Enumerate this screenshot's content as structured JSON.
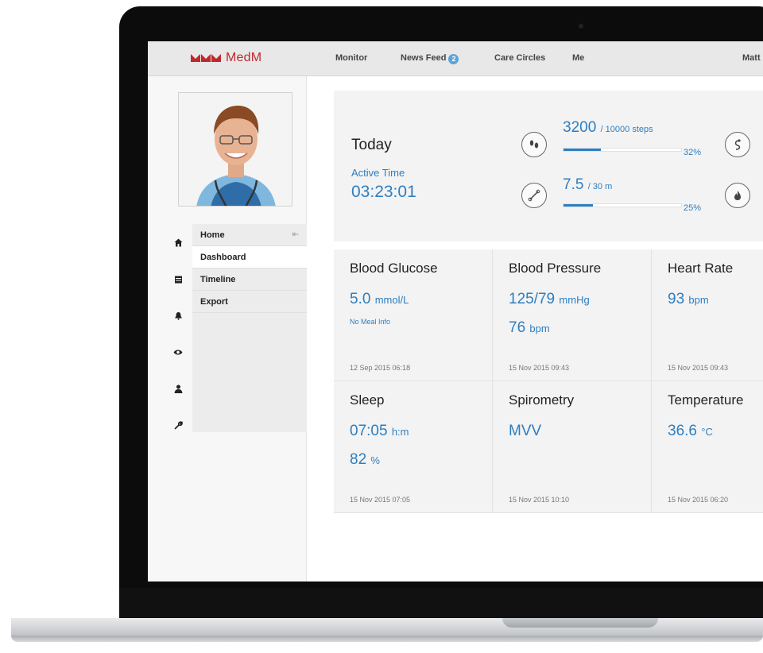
{
  "brand": {
    "name": "MedM",
    "accent": "#c0282d",
    "blue": "#2e7ec1"
  },
  "nav": {
    "items": [
      "Monitor",
      "News Feed",
      "Care Circles",
      "Me"
    ],
    "news_badge": "2",
    "user": "Matt"
  },
  "sidebar": {
    "icons": [
      "home-icon",
      "calendar-icon",
      "bell-icon",
      "eye-icon",
      "person-icon",
      "wrench-icon"
    ],
    "menu": [
      "Home",
      "Dashboard",
      "Timeline",
      "Export"
    ],
    "active": "Dashboard"
  },
  "today": {
    "title": "Today",
    "active_label": "Active Time",
    "active_value": "03:23:01",
    "steps": {
      "value": "3200",
      "unit": "/ 10000 steps",
      "percent": "32%",
      "progress": 0.32
    },
    "distance": {
      "value": "7.5",
      "unit": "/ 30 m",
      "percent": "25%",
      "progress": 0.25
    }
  },
  "tiles": [
    {
      "title": "Blood Glucose",
      "v1": "5.0",
      "u1": "mmol/L",
      "note": "No Meal Info",
      "date": "12 Sep 2015 06:18"
    },
    {
      "title": "Blood Pressure",
      "v1": "125/79",
      "u1": "mmHg",
      "v2": "76",
      "u2": "bpm",
      "date": "15 Nov 2015 09:43"
    },
    {
      "title": "Heart Rate",
      "v1": "93",
      "u1": "bpm",
      "date": "15 Nov 2015 09:43"
    },
    {
      "title": "Sleep",
      "v1": "07:05",
      "u1": "h:m",
      "v2": "82",
      "u2": "%",
      "date": "15 Nov 2015 07:05"
    },
    {
      "title": "Spirometry",
      "v1": "MVV",
      "u1": "",
      "date": "15 Nov 2015 10:10"
    },
    {
      "title": "Temperature",
      "v1": "36.6",
      "u1": "°C",
      "date": "15 Nov 2015 06:20"
    }
  ]
}
